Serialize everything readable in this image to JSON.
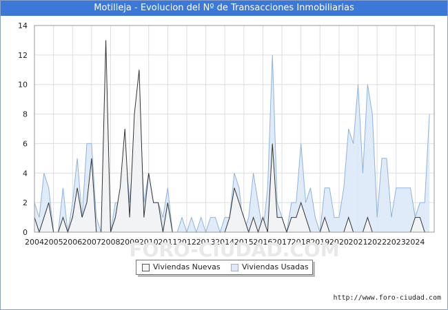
{
  "page": {
    "title": "Motilleja - Evolucion del Nº de Transacciones Inmobiliarias",
    "source": "http://www.foro-ciudad.com",
    "watermark": "FORO-CIUDAD.COM"
  },
  "colors": {
    "title_bg": "#3b78d8",
    "nuevas_fill": "#f4f4f4",
    "nuevas_line": "#333333",
    "usadas_fill": "#dde9f8",
    "usadas_line": "#8db3e2",
    "grid": "#dddddd"
  },
  "legend": {
    "nuevas_label": "Viviendas Nuevas",
    "usadas_label": "Viviendas Usadas"
  },
  "chart_data": {
    "type": "area",
    "title": "Motilleja - Evolucion del Nº de Transacciones Inmobiliarias",
    "xlabel": "",
    "ylabel": "",
    "x_start_year": 2004,
    "periods_per_year": 4,
    "x_tick_labels": [
      "2004",
      "2005",
      "2006",
      "2007",
      "2008",
      "2009",
      "2010",
      "2011",
      "2012",
      "2013",
      "2014",
      "2015",
      "2016",
      "2017",
      "2018",
      "2019",
      "2020",
      "2021",
      "2022",
      "2023",
      "2024"
    ],
    "ylim": [
      0,
      14
    ],
    "y_ticks": [
      0,
      2,
      4,
      6,
      8,
      10,
      12,
      14
    ],
    "grid": true,
    "legend_position": "bottom-center",
    "series": [
      {
        "name": "Viviendas Nuevas",
        "values": [
          1,
          0,
          1,
          2,
          0,
          0,
          1,
          0,
          1,
          3,
          1,
          2,
          5,
          0,
          0,
          13,
          0,
          1,
          3,
          7,
          1,
          8,
          11,
          1,
          4,
          2,
          2,
          0,
          2,
          0,
          0,
          0,
          0,
          0,
          0,
          0,
          0,
          0,
          0,
          0,
          0,
          1,
          3,
          2,
          1,
          0,
          1,
          0,
          1,
          0,
          6,
          1,
          1,
          0,
          1,
          1,
          2,
          1,
          0,
          0,
          0,
          1,
          0,
          0,
          0,
          0,
          1,
          0,
          0,
          0,
          1,
          0,
          0,
          0,
          0,
          0,
          0,
          0,
          0,
          0,
          1,
          1,
          0
        ]
      },
      {
        "name": "Viviendas Usadas",
        "values": [
          2,
          1,
          4,
          3,
          0,
          0,
          3,
          0,
          2,
          5,
          1,
          6,
          6,
          1,
          0,
          10,
          0,
          2,
          2,
          6,
          2,
          6,
          9,
          2,
          4,
          2,
          2,
          1,
          3,
          0,
          0,
          1,
          0,
          1,
          0,
          1,
          0,
          1,
          1,
          0,
          1,
          1,
          4,
          3,
          0,
          1,
          4,
          2,
          0,
          3,
          12,
          2,
          1,
          0,
          2,
          2,
          6,
          2,
          3,
          1,
          0,
          3,
          3,
          1,
          1,
          3,
          7,
          6,
          10,
          4,
          10,
          8,
          1,
          5,
          5,
          1,
          3,
          3,
          3,
          3,
          1,
          2,
          2,
          8
        ]
      }
    ]
  }
}
